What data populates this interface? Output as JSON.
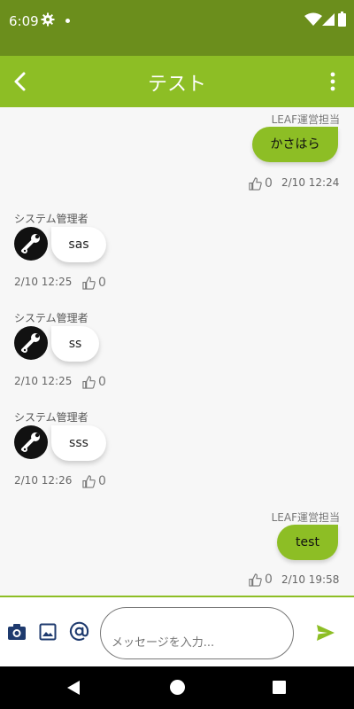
{
  "status_bar": {
    "time": "6:09"
  },
  "header": {
    "title": "テスト"
  },
  "messages": [
    {
      "side": "right",
      "sender": "LEAF運営担当",
      "text": "かさはら",
      "date": "2/10 12:24",
      "likes": "0"
    },
    {
      "side": "left",
      "sender": "システム管理者",
      "text": "sas",
      "date": "2/10 12:25",
      "likes": "0"
    },
    {
      "side": "left",
      "sender": "システム管理者",
      "text": "ss",
      "date": "2/10 12:25",
      "likes": "0"
    },
    {
      "side": "left",
      "sender": "システム管理者",
      "text": "sss",
      "date": "2/10 12:26",
      "likes": "0"
    },
    {
      "side": "right",
      "sender": "LEAF運営担当",
      "text": "test",
      "date": "2/10 19:58",
      "likes": "0"
    }
  ],
  "composer": {
    "placeholder": "メッセージを入力..."
  },
  "colors": {
    "status_bar": "#6b8e1c",
    "app_bar": "#8dbe25",
    "own_bubble": "#8dbe25",
    "icon_blue": "#1e3a6e"
  },
  "icons": [
    "gear-icon",
    "wifi-icon",
    "signal-icon",
    "battery-icon",
    "back-arrow-icon",
    "more-vert-icon",
    "wrench-gear-icon",
    "thumbs-up-icon",
    "camera-icon",
    "image-icon",
    "at-sign-icon",
    "send-icon"
  ]
}
